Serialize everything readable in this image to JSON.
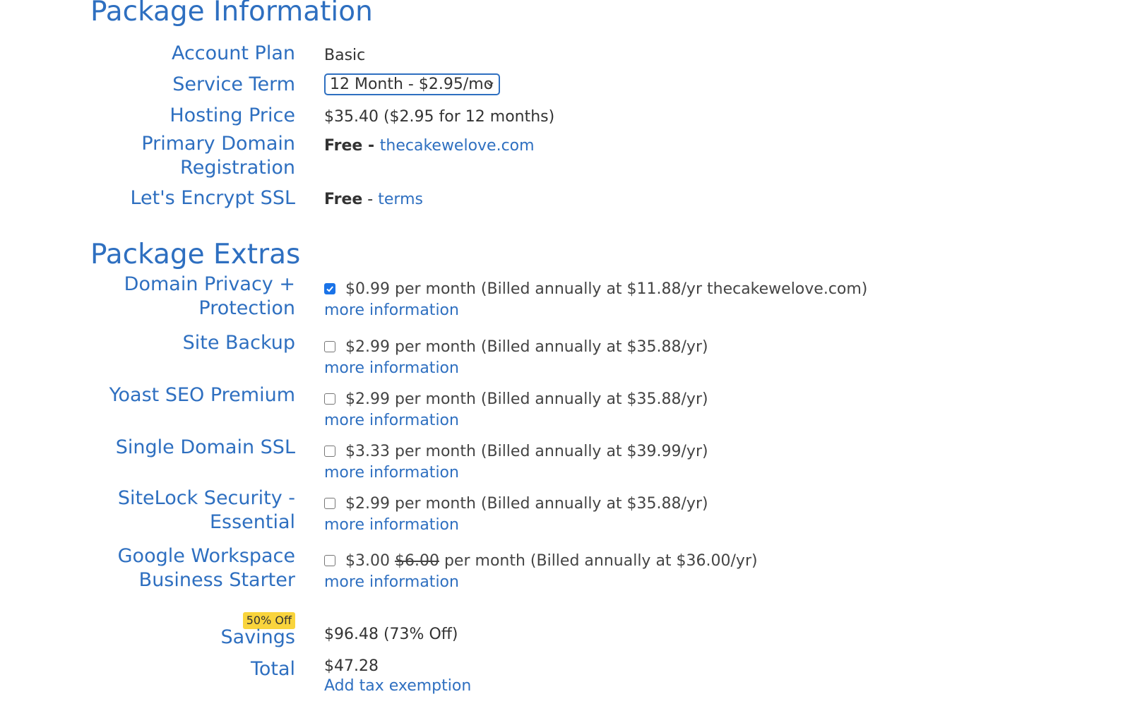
{
  "package_info": {
    "title": "Package Information",
    "rows": {
      "account_plan": {
        "label": "Account Plan",
        "value": "Basic"
      },
      "service_term": {
        "label": "Service Term",
        "selected": "12 Month - $2.95/mo"
      },
      "hosting_price": {
        "label": "Hosting Price",
        "value": "$35.40 ($2.95 for 12 months)"
      },
      "primary_domain": {
        "label_line1": "Primary Domain",
        "label_line2": "Registration",
        "prefix": "Free",
        "separator": " - ",
        "domain": "thecakewelove.com"
      },
      "ssl": {
        "label": "Let's Encrypt SSL",
        "prefix": "Free",
        "separator": " - ",
        "link": "terms"
      }
    }
  },
  "package_extras": {
    "title": "Package Extras",
    "more_info_label": "more information",
    "items": [
      {
        "label_line1": "Domain Privacy +",
        "label_line2": "Protection",
        "checked": true,
        "price_text": "$0.99 per month (Billed annually at $11.88/yr thecakewelove.com)"
      },
      {
        "label_line1": "Site Backup",
        "checked": false,
        "price_text": "$2.99 per month (Billed annually at $35.88/yr)"
      },
      {
        "label_line1": "Yoast SEO Premium",
        "checked": false,
        "price_text": "$2.99 per month (Billed annually at $35.88/yr)"
      },
      {
        "label_line1": "Single Domain SSL",
        "checked": false,
        "price_text": "$3.33 per month (Billed annually at $39.99/yr)"
      },
      {
        "label_line1": "SiteLock Security -",
        "label_line2": "Essential",
        "checked": false,
        "price_text": "$2.99 per month (Billed annually at $35.88/yr)"
      },
      {
        "label_line1": "Google Workspace",
        "label_line2": "Business Starter",
        "badge": "50% Off",
        "checked": false,
        "price_new": "$3.00",
        "price_old": "$6.00",
        "price_rest": "per month (Billed annually at $36.00/yr)"
      }
    ]
  },
  "summary": {
    "savings": {
      "label": "Savings",
      "value": "$96.48 (73% Off)"
    },
    "total": {
      "label": "Total",
      "value": "$47.28",
      "link": "Add tax exemption"
    }
  },
  "colors": {
    "accent": "#2e6fc0",
    "checkbox_checked": "#1a73e8",
    "badge": "#f9d43c",
    "text": "#333333"
  }
}
